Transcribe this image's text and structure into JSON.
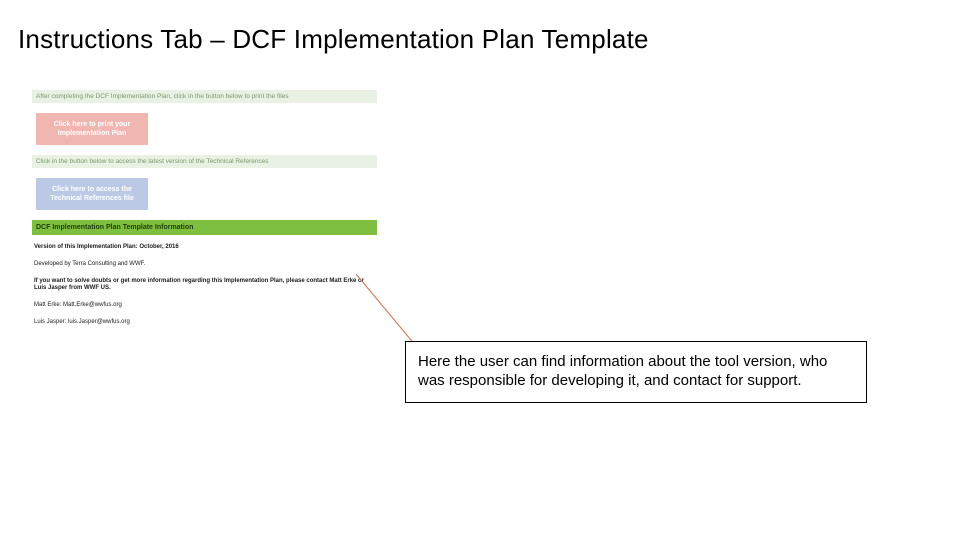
{
  "title": "Instructions Tab – DCF Implementation Plan Template",
  "module": {
    "hint_print": "After completing the DCF Implementation Plan, click in the button below to print the files",
    "btn_print": "Click here to print your Implementation Plan",
    "hint_ref": "Click in the button below to access the latest version of the Technical References",
    "btn_ref": "Click here to access the Technical References file",
    "green_header": "DCF Implementation Plan Template Information",
    "info_version": "Version of this Implementation Plan: October, 2016",
    "info_dev": "Developed by Terra Consulting and WWF.",
    "info_contact": "If you want to solve doubts or get more information regarding this Implementation Plan, please contact Matt Erke or Luis Jasper from WWF US.",
    "info_email1": "Matt Erke: Matt.Erke@wwfus.org",
    "info_email2": "Luis Jasper: luis.Jasper@wwfus.org"
  },
  "callout": "Here the user can find information about the tool version, who was responsible for developing it, and contact for support."
}
